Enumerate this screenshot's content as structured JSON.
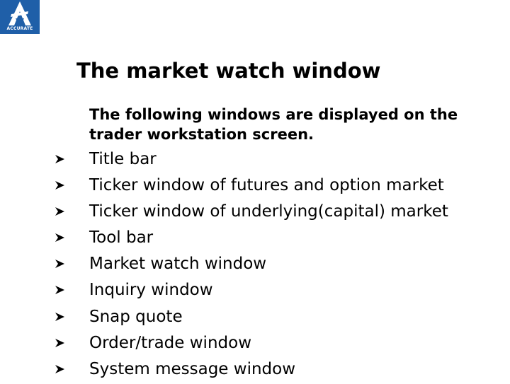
{
  "logo": {
    "text": "ACCURATE",
    "bg_color": "#1f5fa8"
  },
  "title": "The market watch window",
  "intro": "The following windows are displayed on the trader workstation screen.",
  "bullet_icon": "arrowhead-bullet-icon",
  "items": [
    "Title bar",
    "Ticker window of futures and option market",
    "Ticker window of underlying(capital) market",
    "Tool bar",
    "Market watch window",
    "Inquiry window",
    "Snap quote",
    "Order/trade window",
    "System message window"
  ]
}
